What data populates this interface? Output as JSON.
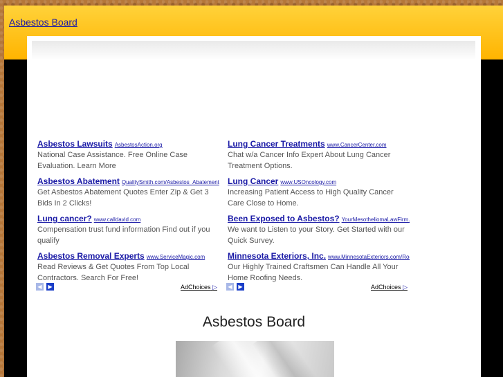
{
  "header": {
    "site_link": "Asbestos Board"
  },
  "ads": {
    "left": [
      {
        "title": "Asbestos Lawsuits",
        "url": "AsbestosAction.org",
        "desc": "National Case Assistance. Free Online Case Evaluation. Learn More"
      },
      {
        "title": "Asbestos Abatement",
        "url": "QualitySmith.com/Asbestos_Abatement",
        "desc": "Get Asbestos Abatement Quotes Enter Zip & Get 3 Bids In 2 Clicks!"
      },
      {
        "title": "Lung cancer?",
        "url": "www.calldavid.com",
        "desc": "Compensation trust fund information Find out if you qualify"
      },
      {
        "title": "Asbestos Removal Experts",
        "url": "www.ServiceMagic.com",
        "desc": "Read Reviews & Get Quotes From Top Local Contractors. Search For Free!"
      }
    ],
    "right": [
      {
        "title": "Lung Cancer Treatments",
        "url": "www.CancerCenter.com",
        "desc": "Chat w/a Cancer Info Expert About Lung Cancer Treatment Options."
      },
      {
        "title": "Lung Cancer",
        "url": "www.USOncology.com",
        "desc": "Increasing Patient Access to High Quality Cancer Care Close to Home."
      },
      {
        "title": "Been Exposed to Asbestos?",
        "url": "YourMesotheliomaLawFirm.com",
        "desc": "We want to Listen to your Story. Get Started with our Quick Survey."
      },
      {
        "title": "Minnesota Exteriors, Inc.",
        "url": "www.MinnesotaExteriors.com/Roofing",
        "desc": "Our Highly Trained Craftsmen Can Handle All Your Home Roofing Needs."
      }
    ],
    "adchoices_label": "AdChoices",
    "prev_glyph": "◀",
    "next_glyph": "▶",
    "adchoices_glyph": "▷"
  },
  "main": {
    "title": "Asbestos Board"
  }
}
